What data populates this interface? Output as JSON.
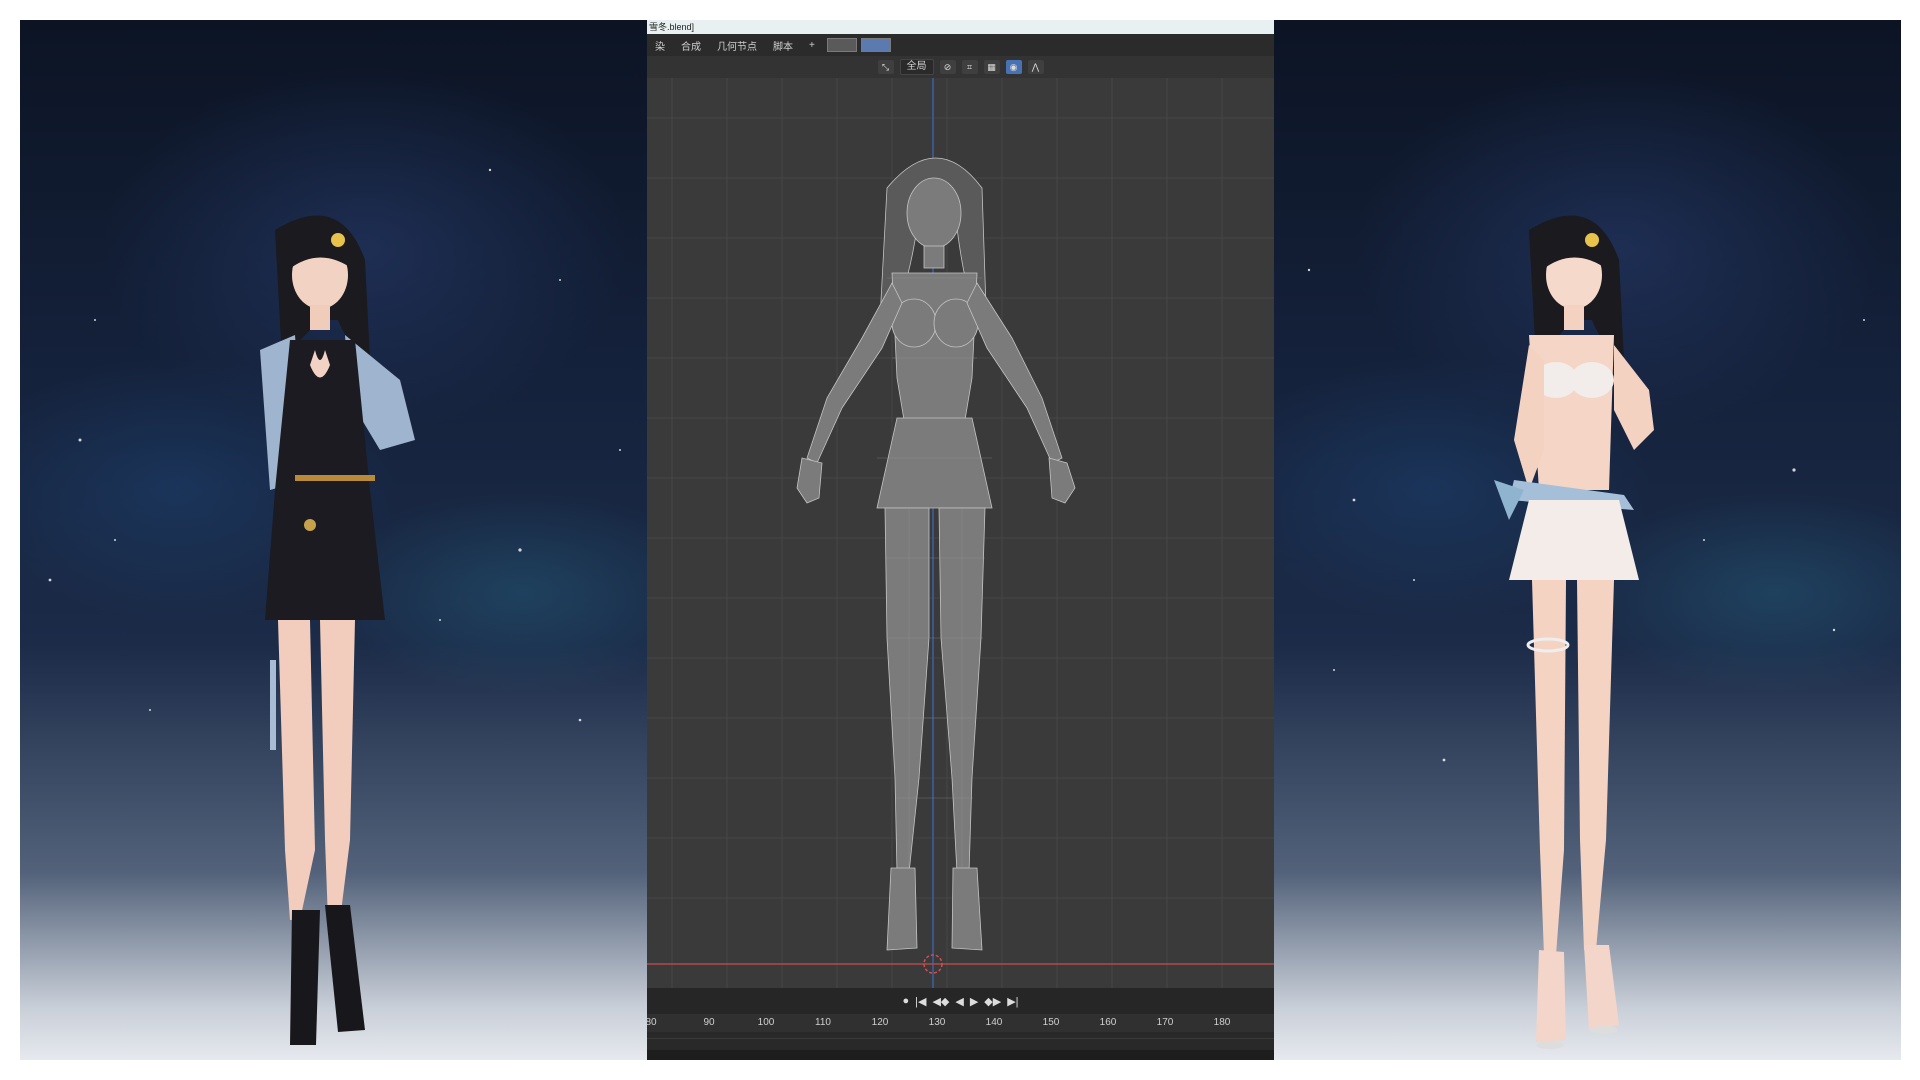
{
  "window": {
    "title": "雪冬.blend]"
  },
  "menu": {
    "items": [
      "染",
      "合成",
      "几何节点",
      "脚本",
      "+"
    ]
  },
  "header": {
    "view_select": "全局",
    "icons": [
      "transform-orientation-icon",
      "proportional-edit-icon",
      "snap-icon",
      "overlay-icon",
      "wave-icon"
    ]
  },
  "timeline": {
    "ruler_labels": [
      "80",
      "90",
      "100",
      "110",
      "120",
      "130",
      "140",
      "150",
      "160",
      "170",
      "180"
    ],
    "controls": [
      "●",
      "|◀",
      "◀◆",
      "◀",
      "▶",
      "◆▶",
      "▶|"
    ]
  },
  "colors": {
    "viewport_bg": "#3a3a3a",
    "grid": "#444444",
    "x_axis": "#b04a4a",
    "z_axis": "#3d5fa3",
    "mesh": "#b5b5b5"
  }
}
